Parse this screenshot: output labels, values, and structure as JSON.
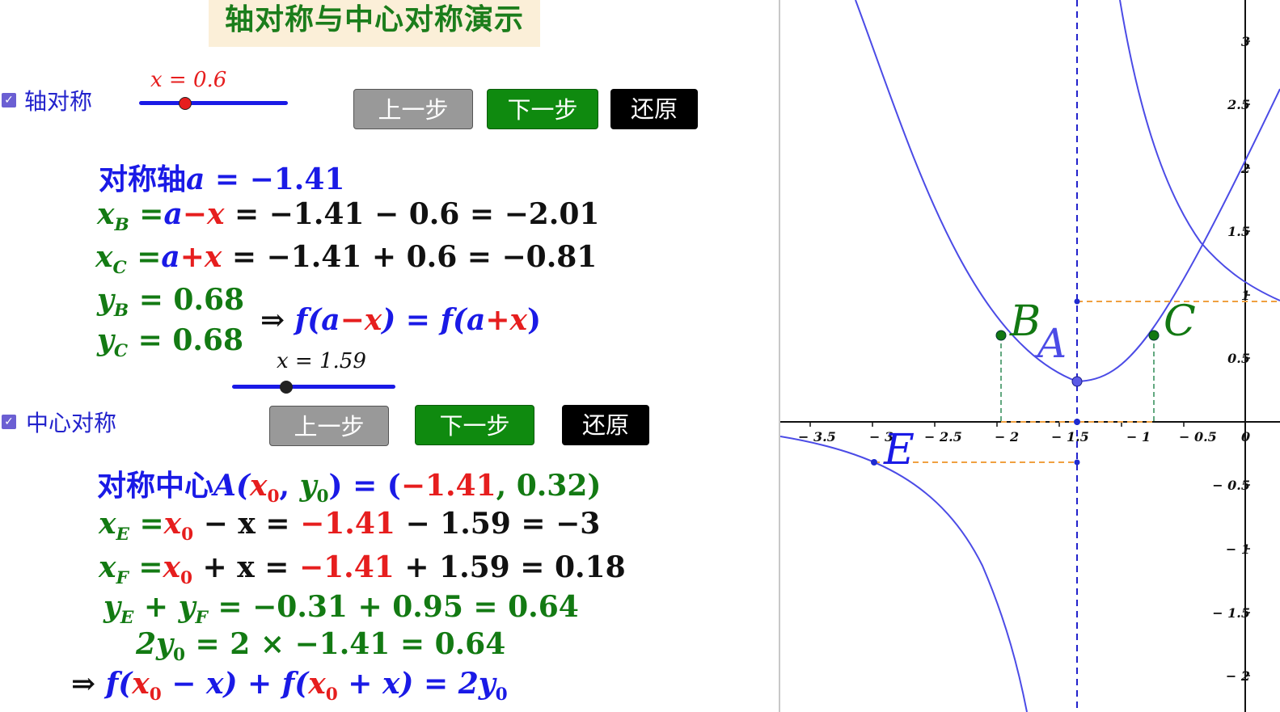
{
  "title": "轴对称与中心对称演示",
  "axis_section": {
    "checkbox_label": "轴对称",
    "checkbox_checked": true,
    "slider_label": "x = 0.6",
    "slider_value": 0.6,
    "buttons": {
      "prev": "上一步",
      "next": "下一步",
      "reset": "还原"
    },
    "formula_axis_prefix": "对称轴",
    "a_symbol": "a",
    "eq_a": " = −1.41",
    "xb_lhs": "x",
    "xb_sub": "B",
    "xb_eq": " =",
    "a1": "a",
    "minus": "−",
    "x1": "x",
    "xb_rest": " = −1.41 − 0.6 = −2.01",
    "xc_lhs": "x",
    "xc_sub": "C",
    "xc_eq": " =",
    "a2": "a",
    "plus": "+",
    "x2": "x",
    "xc_rest": " = −1.41 + 0.6 = −0.81",
    "yb_lhs": "y",
    "yb_sub": "B",
    "yb_rest": " = 0.68",
    "yc_lhs": "y",
    "yc_sub": "C",
    "yc_rest": " = 0.68",
    "implies": "⇒",
    "f1": "f(",
    "a3": "a",
    "minus2": "−",
    "x3": "x",
    "mid": ") = f(",
    "a4": "a",
    "plus2": "+",
    "x4": "x",
    "close": ")"
  },
  "center_section": {
    "checkbox_label": "中心对称",
    "checkbox_checked": true,
    "slider_label": "x = 1.59",
    "slider_value": 1.59,
    "buttons": {
      "prev": "上一步",
      "next": "下一步",
      "reset": "还原"
    },
    "center_prefix": "对称中心",
    "center_A": "A(",
    "x0": "x",
    "sub0": "0",
    "comma": ", ",
    "y0": "y",
    "sub0b": "0",
    "center_mid": ") = (",
    "neg141": "−1.41",
    "center_comma2": ", 0.32)",
    "xe_lhs": "x",
    "xe_sub": "E",
    "xe_eq": " =",
    "xe_x0": "x",
    "xe_x0sub": "0",
    "xe_rest1": " − x = ",
    "xe_val": "−1.41",
    "xe_rest2": " − 1.59 = −3",
    "xf_lhs": "x",
    "xf_sub": "F",
    "xf_eq": " =",
    "xf_x0": "x",
    "xf_x0sub": "0",
    "xf_rest1": " + x = ",
    "xf_val": "−1.41",
    "xf_rest2": " + 1.59 = 0.18",
    "ye_line": "y",
    "ye_sub": "E",
    "ye_plus": " + y",
    "yf_sub": "F",
    "ye_rest": " = −0.31 + 0.95 = 0.64",
    "two_y0": "2y",
    "two_y0_sub": "0",
    "two_rest": " = 2 × −1.41 = 0.64",
    "implies": "⇒",
    "f_open": "f(",
    "fx0a": "x",
    "fx0a_sub": "0",
    "f_minus_x": " − x) + f(",
    "fx0b": "x",
    "fx0b_sub": "0",
    "f_plus_x": " + x) = 2y",
    "f_y0_sub": "0"
  },
  "graph": {
    "x_ticks": [
      "− 3.5",
      "− 3",
      "− 2.5",
      "− 2",
      "− 1.5",
      "− 1",
      "− 0.5",
      "0"
    ],
    "y_ticks": [
      "3",
      "2.5",
      "2",
      "1.5",
      "1",
      "0.5",
      "− 0.5",
      "− 1",
      "− 1.5",
      "− 2"
    ],
    "point_labels": {
      "B": "B",
      "A": "A",
      "C": "C",
      "E": "E"
    },
    "colors": {
      "curve": "#4b4be6",
      "axis_line": "#2222cc",
      "dashed_orange": "#f0a040",
      "point_green": "#127812",
      "point_blue": "#1f2bd0"
    }
  }
}
